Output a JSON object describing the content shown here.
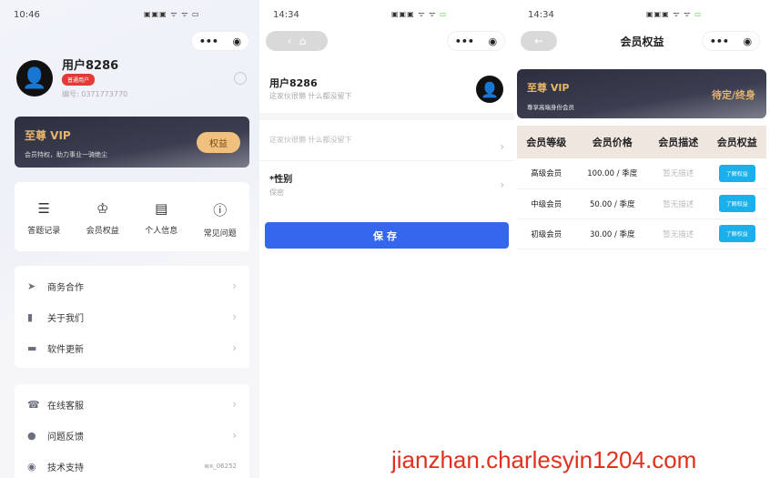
{
  "profile": {
    "time": "10:46",
    "username": "用户8286",
    "badge": "普通用户",
    "id_text": "编号: 0371773770",
    "vip_title": "至尊 VIP",
    "vip_sub": "会员特权，助力事业一骑绝尘",
    "vip_button": "权益",
    "grid": [
      {
        "icon": "list-icon",
        "label": "答题记录"
      },
      {
        "icon": "crown-icon",
        "label": "会员权益"
      },
      {
        "icon": "id-card-icon",
        "label": "个人信息"
      },
      {
        "icon": "question-icon",
        "label": "常见问题"
      }
    ],
    "menu1": [
      {
        "icon": "send-icon",
        "label": "商务合作"
      },
      {
        "icon": "bookmark-icon",
        "label": "关于我们"
      },
      {
        "icon": "message-icon",
        "label": "软件更新"
      }
    ],
    "menu2": [
      {
        "icon": "headset-icon",
        "label": "在线客服"
      },
      {
        "icon": "info-icon",
        "label": "问题反馈"
      },
      {
        "icon": "support-icon",
        "label": "技术支持",
        "value": "wx_06252"
      }
    ]
  },
  "edit": {
    "time": "14:34",
    "username": "用户8286",
    "bio": "这家伙很懒 什么都没留下",
    "bio_field": "这家伙很懒 什么都没留下",
    "gender_label": "*性别",
    "gender_value": "保密",
    "save": "保存"
  },
  "benefits": {
    "time": "14:34",
    "title": "会员权益",
    "vip_title": "至尊 VIP",
    "vip_sub": "尊享高端身份会员",
    "vip_term": "待定/终身",
    "headers": [
      "会员等级",
      "会员价格",
      "会员描述",
      "会员权益"
    ],
    "rows": [
      {
        "level": "高级会员",
        "price": "100.00 / 季度",
        "desc": "暂无描述",
        "action": "了解权益"
      },
      {
        "level": "中级会员",
        "price": "50.00 / 季度",
        "desc": "暂无描述",
        "action": "了解权益"
      },
      {
        "level": "初级会员",
        "price": "30.00 / 季度",
        "desc": "暂无描述",
        "action": "了解权益"
      }
    ]
  },
  "watermark": "jianzhan.charlesyin1204.com"
}
